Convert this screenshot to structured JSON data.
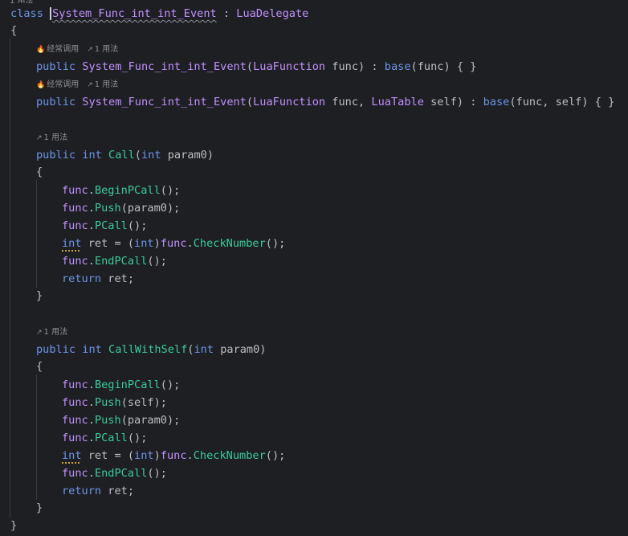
{
  "editor": {
    "class_decl": {
      "keyword": "class",
      "name": "System_Func_int_int_Event",
      "colon": " : ",
      "base_type": "LuaDelegate"
    },
    "hints": {
      "frequent": "经常调用",
      "one_usage": "1 用法"
    },
    "ctor1": {
      "mod": "public",
      "name": "System_Func_int_int_Event",
      "open": "(",
      "ptype": "LuaFunction",
      "pname": " func",
      "close": ") : ",
      "base_kw": "base",
      "base_args": "(func) { }"
    },
    "ctor2": {
      "mod": "public",
      "name": "System_Func_int_int_Event",
      "open": "(",
      "ptype1": "LuaFunction",
      "pname1": " func, ",
      "ptype2": "LuaTable",
      "pname2": " self",
      "close": ") : ",
      "base_kw": "base",
      "base_args": "(func, self) { }"
    },
    "method1": {
      "mod": "public",
      "ret": "int",
      "name": "Call",
      "open": "(",
      "ptype": "int",
      "pname": " param0)"
    },
    "method2": {
      "mod": "public",
      "ret": "int",
      "name": "CallWithSelf",
      "open": "(",
      "ptype": "int",
      "pname": " param0)"
    },
    "body": {
      "func": "func",
      "dot": ".",
      "begin": "BeginPCall",
      "push": "Push",
      "pcall": "PCall",
      "check": "CheckNumber",
      "end": "EndPCall",
      "call_empty": "();",
      "push_param": "(param0);",
      "push_self": "(self);",
      "int_kw": "int",
      "ret_decl": " ret = (",
      "cast_close": ")",
      "return_kw": "return",
      "return_val": " ret;"
    },
    "braces": {
      "open": "{",
      "close": "}"
    }
  }
}
